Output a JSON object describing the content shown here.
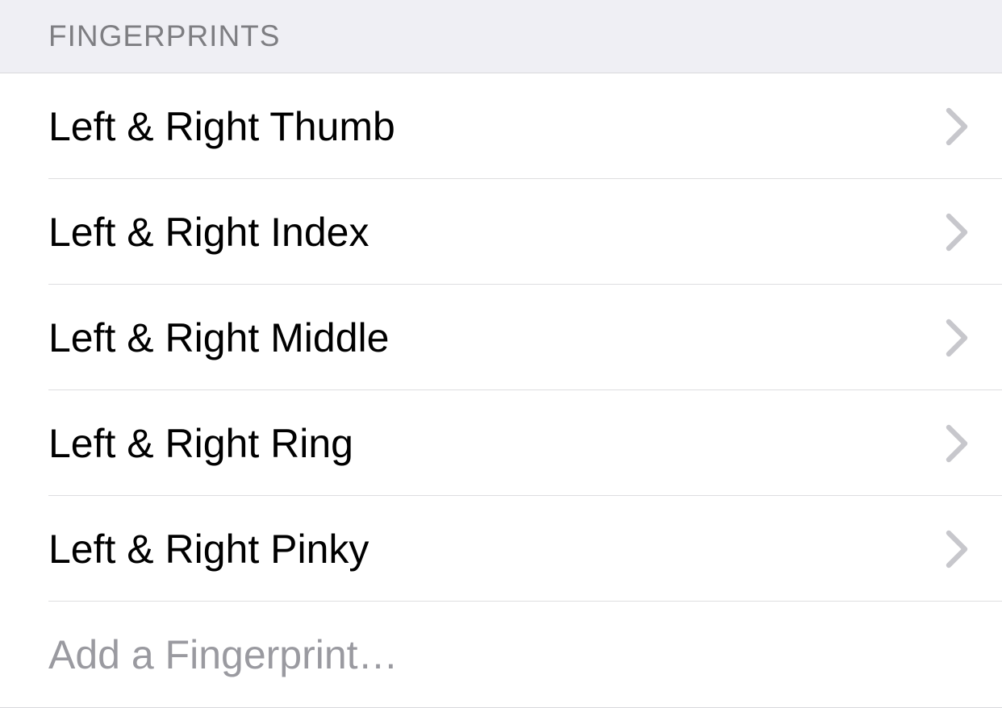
{
  "section": {
    "header": "FINGERPRINTS",
    "items": [
      {
        "label": "Left & Right Thumb"
      },
      {
        "label": "Left & Right Index"
      },
      {
        "label": "Left & Right Middle"
      },
      {
        "label": "Left & Right Ring"
      },
      {
        "label": "Left & Right Pinky"
      }
    ],
    "add_label": "Add a Fingerprint…"
  }
}
